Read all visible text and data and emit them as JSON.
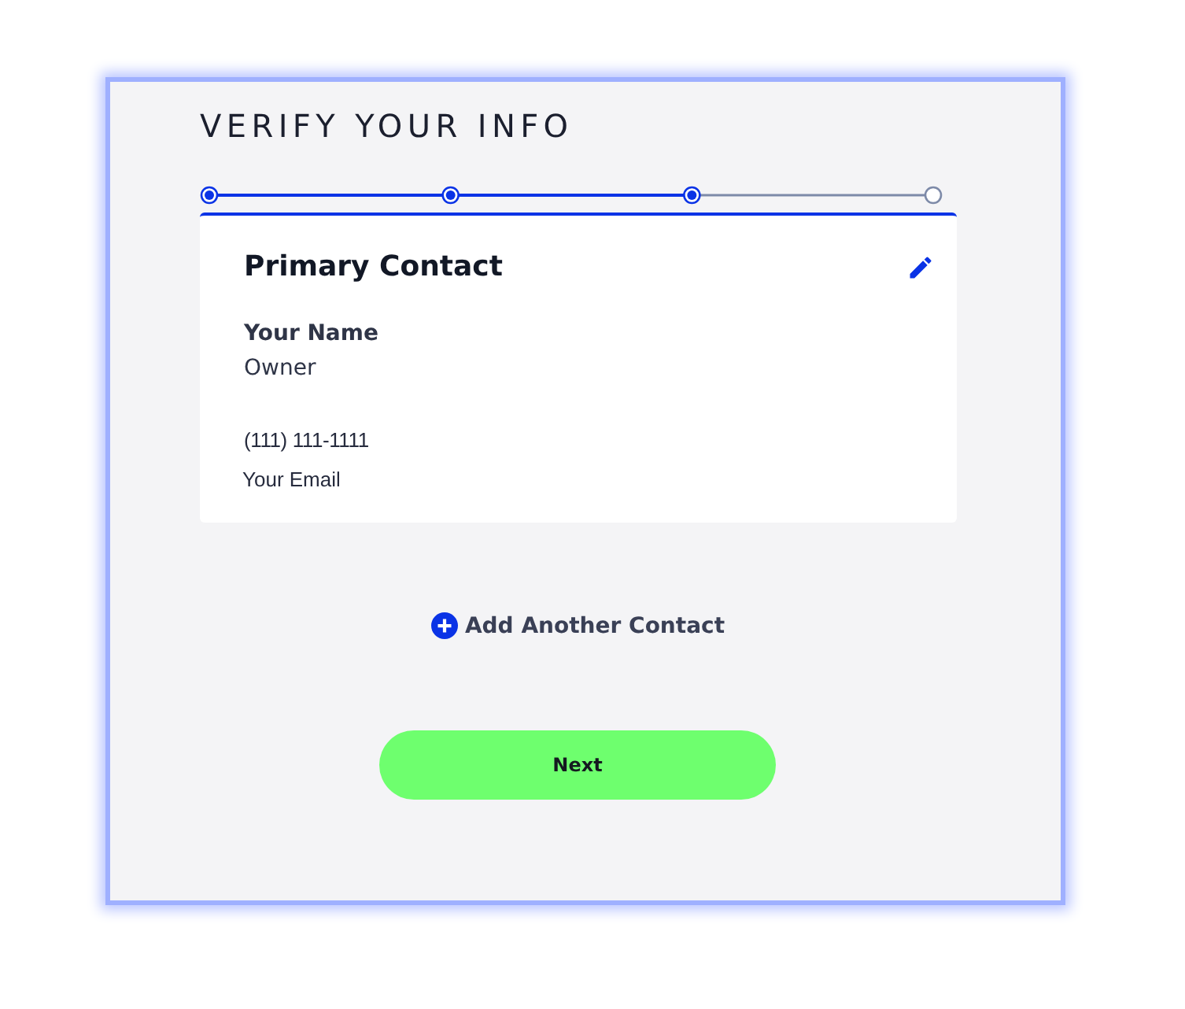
{
  "title": "VERIFY YOUR INFO",
  "steps": [
    {
      "completed": true
    },
    {
      "completed": true
    },
    {
      "completed": true
    },
    {
      "completed": false
    }
  ],
  "contact": {
    "heading": "Primary Contact",
    "name_label": "Your Name",
    "name": "Owner",
    "phone": "(111) 111-1111",
    "email": "Your Email"
  },
  "add_contact": {
    "label": "Add Another Contact"
  },
  "next_button": {
    "label": "Next"
  }
}
